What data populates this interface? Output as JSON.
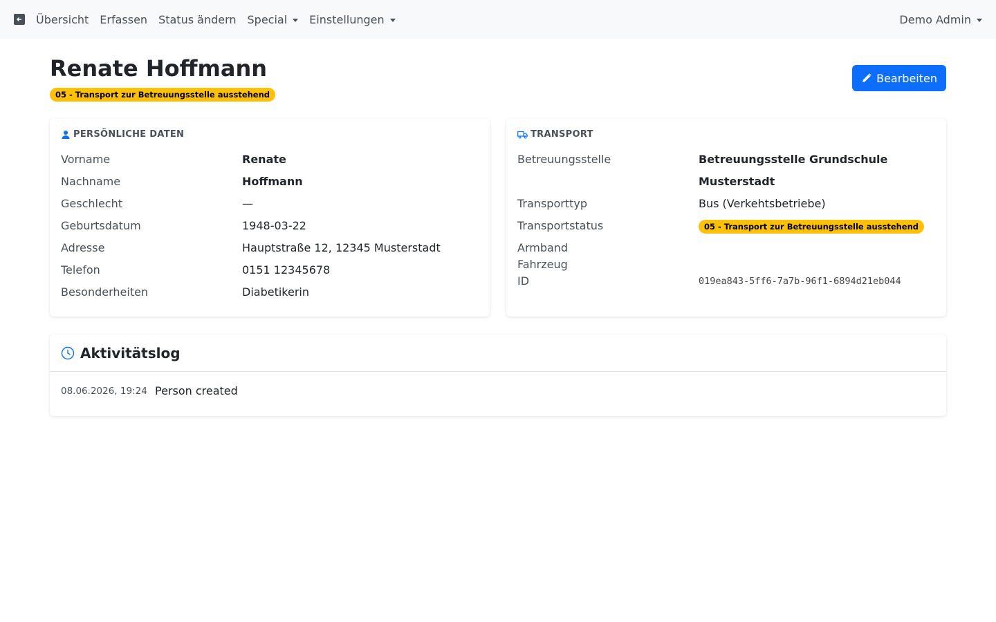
{
  "nav": {
    "links": [
      "Übersicht",
      "Erfassen",
      "Status ändern",
      "Special",
      "Einstellungen"
    ],
    "user": "Demo Admin"
  },
  "person": {
    "title": "Renate Hoffmann",
    "status_badge": "05 - Transport zur Betreuungsstelle ausstehend",
    "edit_label": "Bearbeiten"
  },
  "personal": {
    "heading": "PERSÖNLICHE DATEN",
    "fields": [
      {
        "label": "Vorname",
        "value": "Renate"
      },
      {
        "label": "Nachname",
        "value": "Hoffmann"
      },
      {
        "label": "Geschlecht",
        "value": "—"
      },
      {
        "label": "Geburtsdatum",
        "value": "1948-03-22"
      },
      {
        "label": "Adresse",
        "value": "Hauptstraße 12, 12345 Musterstadt"
      },
      {
        "label": "Telefon",
        "value": "0151 12345678"
      },
      {
        "label": "Besonderheiten",
        "value": "Diabetikerin"
      }
    ]
  },
  "transport": {
    "heading": "TRANSPORT",
    "fields": [
      {
        "label": "Betreuungsstelle",
        "value": "Betreuungsstelle Grundschule Musterstadt"
      },
      {
        "label": "Transporttyp",
        "value": "Bus (Verkehtsbetriebe)"
      },
      {
        "label": "Transportstatus",
        "value": "05 - Transport zur Betreuungsstelle ausstehend"
      },
      {
        "label": "Armband",
        "value": ""
      },
      {
        "label": "Fahrzeug",
        "value": ""
      },
      {
        "label": "ID",
        "value": "019ea843-5ff6-7a7b-96f1-6894d21eb044"
      }
    ]
  },
  "log": {
    "heading": "Aktivitätslog",
    "entries": [
      {
        "time": "08.06.2026, 19:24",
        "message": "Person created"
      }
    ]
  },
  "colors": {
    "primary": "#0d6efd",
    "warning": "#ffc107",
    "navbar": "#f8f9fa"
  }
}
